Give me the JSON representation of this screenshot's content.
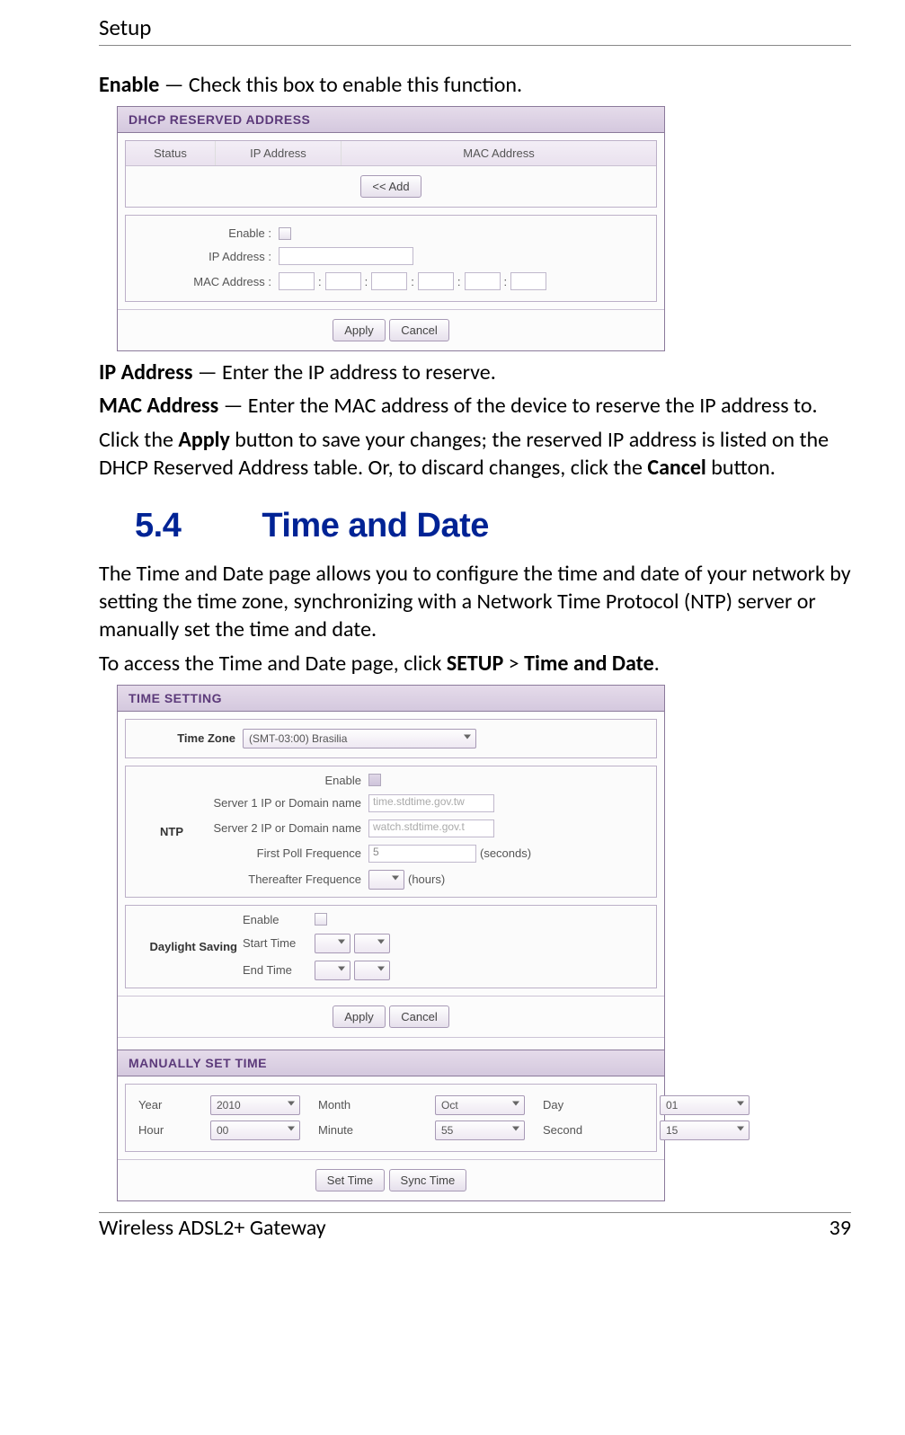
{
  "page_header": "Setup",
  "enable_line": {
    "bold": "Enable",
    "rest": " — Check this box to enable this function."
  },
  "dhcp_panel": {
    "title": "DHCP RESERVED ADDRESS",
    "cols": {
      "status": "Status",
      "ip": "IP Address",
      "mac": "MAC Address"
    },
    "add_btn": "<< Add",
    "enable_lbl": "Enable :",
    "ip_lbl": "IP Address :",
    "mac_lbl": "MAC Address :",
    "apply": "Apply",
    "cancel": "Cancel",
    "sep": ":"
  },
  "ip_line": {
    "bold": "IP Address",
    "rest": " — Enter the IP address to reserve."
  },
  "mac_line": {
    "bold": "MAC Address",
    "rest": " — Enter the MAC address of the device to reserve the IP address to."
  },
  "apply_line": {
    "p1": "Click the ",
    "b1": "Apply",
    "p2": " button to save your changes; the reserved IP address is listed on the DHCP Reserved Address table. Or, to discard changes, click the ",
    "b2": "Cancel",
    "p3": " button."
  },
  "section": {
    "num": "5.4",
    "title": "Time and Date"
  },
  "intro1": "The Time and Date page allows you to configure the time and date of your network by setting the time zone, synchronizing with a Network Time Protocol (NTP) server or manually set the time and date.",
  "intro2": {
    "p1": "To access the Time and Date page, click ",
    "b1": "SETUP",
    "p2": " > ",
    "b2": "Time and Date",
    "p3": "."
  },
  "time_panel": {
    "title": "TIME SETTING",
    "tz_lbl": "Time Zone",
    "tz_val": "(SMT-03:00) Brasilia",
    "ntp_group": "NTP",
    "enable_lbl": "Enable",
    "srv1_lbl": "Server 1 IP or Domain name",
    "srv1_val": "time.stdtime.gov.tw",
    "srv2_lbl": "Server 2 IP or Domain name",
    "srv2_val": "watch.stdtime.gov.t",
    "first_poll_lbl": "First Poll Frequence",
    "first_poll_val": "5",
    "seconds": "(seconds)",
    "thereafter_lbl": "Thereafter Frequence",
    "hours": "(hours)",
    "ds_group": "Daylight Saving",
    "ds_enable": "Enable",
    "ds_start": "Start Time",
    "ds_end": "End Time",
    "apply": "Apply",
    "cancel": "Cancel"
  },
  "manual_panel": {
    "title": "MANUALLY SET TIME",
    "year": "Year",
    "year_v": "2010",
    "month": "Month",
    "month_v": "Oct",
    "day": "Day",
    "day_v": "01",
    "hour": "Hour",
    "hour_v": "00",
    "minute": "Minute",
    "minute_v": "55",
    "second": "Second",
    "second_v": "15",
    "set": "Set Time",
    "sync": "Sync Time"
  },
  "footer": {
    "left": "Wireless ADSL2+ Gateway",
    "right": "39"
  }
}
